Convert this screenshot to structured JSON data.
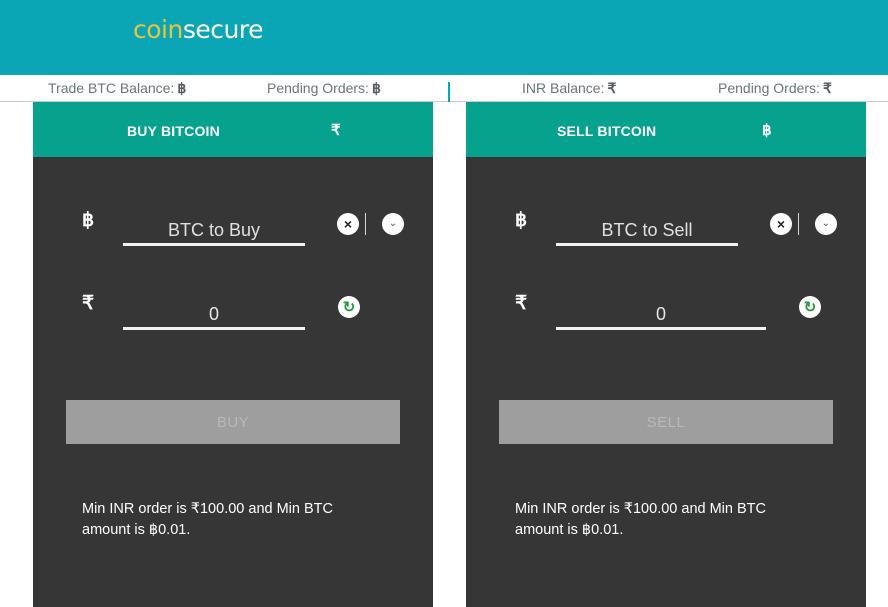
{
  "header": {
    "logo_part1": "coin",
    "logo_part2": "secure",
    "accent": "#0ba6b5",
    "logo_accent": "#e6c43b"
  },
  "balances": {
    "trade_btc_label": "Trade BTC Balance:",
    "pending_btc_label": "Pending Orders:",
    "inr_label": "INR Balance:",
    "pending_inr_label": "Pending Orders:",
    "btc_symbol": "฿",
    "inr_symbol": "₹"
  },
  "buy": {
    "title": "BUY BITCOIN",
    "header_symbol": "₹",
    "btc_symbol": "฿",
    "inr_symbol": "₹",
    "btc_placeholder": "BTC to Buy",
    "inr_value": "0",
    "button_label": "BUY",
    "note_line1": "Min INR order is ₹100.00 and Min BTC",
    "note_line2": "amount is ฿0.01."
  },
  "sell": {
    "title": "SELL BITCOIN",
    "header_symbol": "฿",
    "btc_symbol": "฿",
    "inr_symbol": "₹",
    "btc_placeholder": "BTC to Sell",
    "inr_value": "0",
    "button_label": "SELL",
    "note_line1": "Min INR order is ₹100.00 and Min BTC",
    "note_line2": "amount is ฿0.01."
  },
  "icons": {
    "clear": "×",
    "chevron": "⌄",
    "refresh": "↻"
  },
  "colors": {
    "panel_header": "#06a28e",
    "panel_body": "#363636",
    "button_disabled": "#9e9e9e",
    "refresh_green": "#2a9a3c"
  }
}
